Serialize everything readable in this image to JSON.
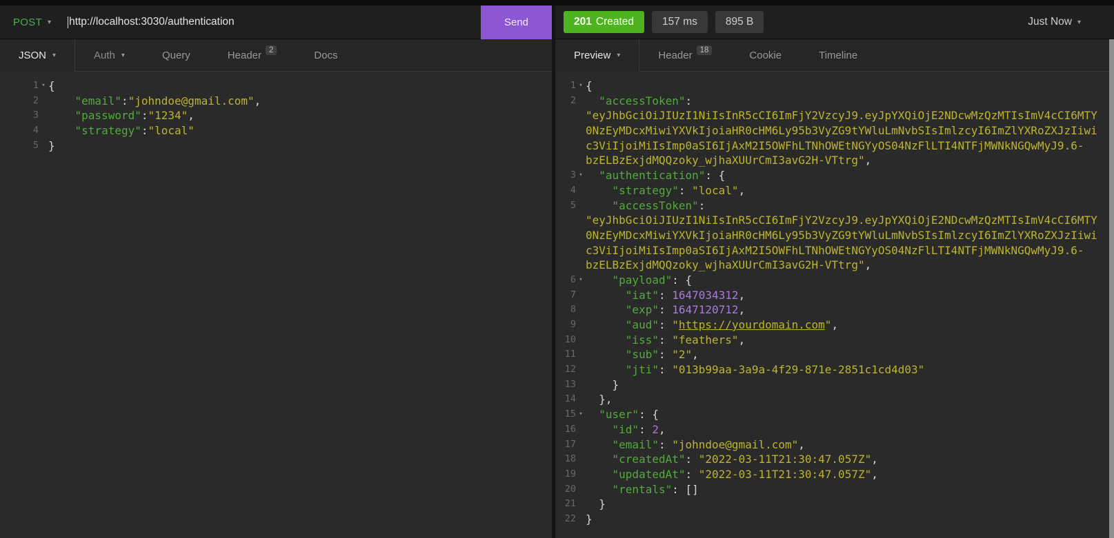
{
  "icons": {
    "chevron_down": "▾",
    "fold_open": "▾"
  },
  "request_bar": {
    "method": "POST",
    "url": "http://localhost:3030/authentication",
    "send_label": "Send"
  },
  "response_bar": {
    "status_code": "201",
    "status_reason": "Created",
    "time": "157 ms",
    "size": "895 B",
    "history": "Just Now"
  },
  "request_tabs": {
    "body_type": "JSON",
    "auth": "Auth",
    "query": "Query",
    "header": "Header",
    "header_count": "2",
    "docs": "Docs"
  },
  "response_tabs": {
    "view": "Preview",
    "header": "Header",
    "header_count": "18",
    "cookie": "Cookie",
    "timeline": "Timeline"
  },
  "colors": {
    "accent_purple": "#8c55d1",
    "status_green": "#4db31e",
    "method_green": "#4caf50",
    "key_green": "#52ab3a",
    "string_yellow": "#beb430",
    "number_purple": "#a97bdc"
  },
  "request_body": {
    "lines": [
      {
        "num": "1",
        "fold": true,
        "parts": [
          {
            "t": "{",
            "c": "p"
          }
        ]
      },
      {
        "num": "2",
        "parts": [
          {
            "t": "    ",
            "c": "p"
          },
          {
            "t": "\"email\"",
            "c": "k"
          },
          {
            "t": ":",
            "c": "p"
          },
          {
            "t": "\"johndoe@gmail.com\"",
            "c": "s"
          },
          {
            "t": ",",
            "c": "p"
          }
        ]
      },
      {
        "num": "3",
        "parts": [
          {
            "t": "    ",
            "c": "p"
          },
          {
            "t": "\"password\"",
            "c": "k"
          },
          {
            "t": ":",
            "c": "p"
          },
          {
            "t": "\"1234\"",
            "c": "s"
          },
          {
            "t": ",",
            "c": "p"
          }
        ]
      },
      {
        "num": "4",
        "parts": [
          {
            "t": "    ",
            "c": "p"
          },
          {
            "t": "\"strategy\"",
            "c": "k"
          },
          {
            "t": ":",
            "c": "p"
          },
          {
            "t": "\"local\"",
            "c": "s"
          }
        ]
      },
      {
        "num": "5",
        "parts": [
          {
            "t": "}",
            "c": "p"
          }
        ]
      }
    ]
  },
  "response_body": {
    "lines": [
      {
        "num": "1",
        "fold": true,
        "parts": [
          {
            "t": "{",
            "c": "p"
          }
        ]
      },
      {
        "num": "2",
        "parts": [
          {
            "t": "  ",
            "c": "p"
          },
          {
            "t": "\"accessToken\"",
            "c": "k"
          },
          {
            "t": ":",
            "c": "p"
          }
        ]
      },
      {
        "num": "",
        "parts": [
          {
            "t": "\"eyJhbGciOiJIUzI1NiIsInR5cCI6ImFjY2VzcyJ9.eyJpYXQiOjE2NDcwMzQzMTIsImV4cCI6MTY",
            "c": "s"
          }
        ]
      },
      {
        "num": "",
        "parts": [
          {
            "t": "0NzEyMDcxMiwiYXVkIjoiaHR0cHM6Ly95b3VyZG9tYWluLmNvbSIsImlzcyI6ImZlYXRoZXJzIiwi",
            "c": "s"
          }
        ]
      },
      {
        "num": "",
        "parts": [
          {
            "t": "c3ViIjoiMiIsImp0aSI6IjAxM2I5OWFhLTNhOWEtNGYyOS04NzFlLTI4NTFjMWNkNGQwMyJ9.6-",
            "c": "s"
          }
        ]
      },
      {
        "num": "",
        "parts": [
          {
            "t": "bzELBzExjdMQQzoky_wjhaXUUrCmI3avG2H-VTtrg\"",
            "c": "s"
          },
          {
            "t": ",",
            "c": "p"
          }
        ]
      },
      {
        "num": "3",
        "fold": true,
        "parts": [
          {
            "t": "  ",
            "c": "p"
          },
          {
            "t": "\"authentication\"",
            "c": "k"
          },
          {
            "t": ": {",
            "c": "p"
          }
        ]
      },
      {
        "num": "4",
        "parts": [
          {
            "t": "    ",
            "c": "p"
          },
          {
            "t": "\"strategy\"",
            "c": "k"
          },
          {
            "t": ": ",
            "c": "p"
          },
          {
            "t": "\"local\"",
            "c": "s"
          },
          {
            "t": ",",
            "c": "p"
          }
        ]
      },
      {
        "num": "5",
        "parts": [
          {
            "t": "    ",
            "c": "p"
          },
          {
            "t": "\"accessToken\"",
            "c": "k"
          },
          {
            "t": ":",
            "c": "p"
          }
        ]
      },
      {
        "num": "",
        "parts": [
          {
            "t": "\"eyJhbGciOiJIUzI1NiIsInR5cCI6ImFjY2VzcyJ9.eyJpYXQiOjE2NDcwMzQzMTIsImV4cCI6MTY",
            "c": "s"
          }
        ]
      },
      {
        "num": "",
        "parts": [
          {
            "t": "0NzEyMDcxMiwiYXVkIjoiaHR0cHM6Ly95b3VyZG9tYWluLmNvbSIsImlzcyI6ImZlYXRoZXJzIiwi",
            "c": "s"
          }
        ]
      },
      {
        "num": "",
        "parts": [
          {
            "t": "c3ViIjoiMiIsImp0aSI6IjAxM2I5OWFhLTNhOWEtNGYyOS04NzFlLTI4NTFjMWNkNGQwMyJ9.6-",
            "c": "s"
          }
        ]
      },
      {
        "num": "",
        "parts": [
          {
            "t": "bzELBzExjdMQQzoky_wjhaXUUrCmI3avG2H-VTtrg\"",
            "c": "s"
          },
          {
            "t": ",",
            "c": "p"
          }
        ]
      },
      {
        "num": "6",
        "fold": true,
        "parts": [
          {
            "t": "    ",
            "c": "p"
          },
          {
            "t": "\"payload\"",
            "c": "k"
          },
          {
            "t": ": {",
            "c": "p"
          }
        ]
      },
      {
        "num": "7",
        "parts": [
          {
            "t": "      ",
            "c": "p"
          },
          {
            "t": "\"iat\"",
            "c": "k"
          },
          {
            "t": ": ",
            "c": "p"
          },
          {
            "t": "1647034312",
            "c": "n"
          },
          {
            "t": ",",
            "c": "p"
          }
        ]
      },
      {
        "num": "8",
        "parts": [
          {
            "t": "      ",
            "c": "p"
          },
          {
            "t": "\"exp\"",
            "c": "k"
          },
          {
            "t": ": ",
            "c": "p"
          },
          {
            "t": "1647120712",
            "c": "n"
          },
          {
            "t": ",",
            "c": "p"
          }
        ]
      },
      {
        "num": "9",
        "parts": [
          {
            "t": "      ",
            "c": "p"
          },
          {
            "t": "\"aud\"",
            "c": "k"
          },
          {
            "t": ": ",
            "c": "p"
          },
          {
            "t": "\"",
            "c": "s"
          },
          {
            "t": "https://yourdomain.com",
            "c": "u"
          },
          {
            "t": "\"",
            "c": "s"
          },
          {
            "t": ",",
            "c": "p"
          }
        ]
      },
      {
        "num": "10",
        "parts": [
          {
            "t": "      ",
            "c": "p"
          },
          {
            "t": "\"iss\"",
            "c": "k"
          },
          {
            "t": ": ",
            "c": "p"
          },
          {
            "t": "\"feathers\"",
            "c": "s"
          },
          {
            "t": ",",
            "c": "p"
          }
        ]
      },
      {
        "num": "11",
        "parts": [
          {
            "t": "      ",
            "c": "p"
          },
          {
            "t": "\"sub\"",
            "c": "k"
          },
          {
            "t": ": ",
            "c": "p"
          },
          {
            "t": "\"2\"",
            "c": "s"
          },
          {
            "t": ",",
            "c": "p"
          }
        ]
      },
      {
        "num": "12",
        "parts": [
          {
            "t": "      ",
            "c": "p"
          },
          {
            "t": "\"jti\"",
            "c": "k"
          },
          {
            "t": ": ",
            "c": "p"
          },
          {
            "t": "\"013b99aa-3a9a-4f29-871e-2851c1cd4d03\"",
            "c": "s"
          }
        ]
      },
      {
        "num": "13",
        "parts": [
          {
            "t": "    }",
            "c": "p"
          }
        ]
      },
      {
        "num": "14",
        "parts": [
          {
            "t": "  },",
            "c": "p"
          }
        ]
      },
      {
        "num": "15",
        "fold": true,
        "parts": [
          {
            "t": "  ",
            "c": "p"
          },
          {
            "t": "\"user\"",
            "c": "k"
          },
          {
            "t": ": {",
            "c": "p"
          }
        ]
      },
      {
        "num": "16",
        "parts": [
          {
            "t": "    ",
            "c": "p"
          },
          {
            "t": "\"id\"",
            "c": "k"
          },
          {
            "t": ": ",
            "c": "p"
          },
          {
            "t": "2",
            "c": "n"
          },
          {
            "t": ",",
            "c": "p"
          }
        ]
      },
      {
        "num": "17",
        "parts": [
          {
            "t": "    ",
            "c": "p"
          },
          {
            "t": "\"email\"",
            "c": "k"
          },
          {
            "t": ": ",
            "c": "p"
          },
          {
            "t": "\"johndoe@gmail.com\"",
            "c": "s"
          },
          {
            "t": ",",
            "c": "p"
          }
        ]
      },
      {
        "num": "18",
        "parts": [
          {
            "t": "    ",
            "c": "p"
          },
          {
            "t": "\"createdAt\"",
            "c": "k"
          },
          {
            "t": ": ",
            "c": "p"
          },
          {
            "t": "\"2022-03-11T21:30:47.057Z\"",
            "c": "s"
          },
          {
            "t": ",",
            "c": "p"
          }
        ]
      },
      {
        "num": "19",
        "parts": [
          {
            "t": "    ",
            "c": "p"
          },
          {
            "t": "\"updatedAt\"",
            "c": "k"
          },
          {
            "t": ": ",
            "c": "p"
          },
          {
            "t": "\"2022-03-11T21:30:47.057Z\"",
            "c": "s"
          },
          {
            "t": ",",
            "c": "p"
          }
        ]
      },
      {
        "num": "20",
        "parts": [
          {
            "t": "    ",
            "c": "p"
          },
          {
            "t": "\"rentals\"",
            "c": "k"
          },
          {
            "t": ": ",
            "c": "p"
          },
          {
            "t": "[]",
            "c": "p"
          }
        ]
      },
      {
        "num": "21",
        "parts": [
          {
            "t": "  }",
            "c": "p"
          }
        ]
      },
      {
        "num": "22",
        "parts": [
          {
            "t": "}",
            "c": "p"
          }
        ]
      }
    ]
  }
}
